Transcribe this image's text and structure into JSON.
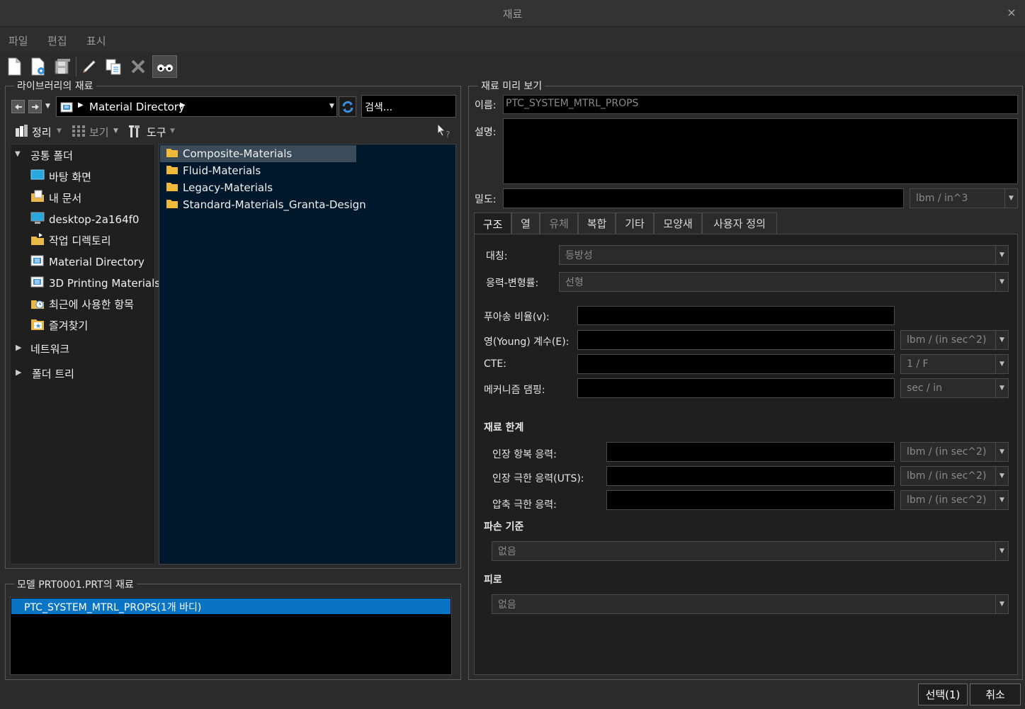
{
  "window": {
    "title": "재료",
    "close": "×"
  },
  "menu": [
    "파일",
    "편집",
    "표시"
  ],
  "library": {
    "group_title": "라이브러리의 재료",
    "path_label": "Material Directory",
    "search_placeholder": "검색...",
    "organize": "정리",
    "view": "보기",
    "tools": "도구",
    "tree": {
      "common_folders": "공통 폴더",
      "items": [
        "바탕 화면",
        "내 문서",
        "desktop-2a164f0",
        "작업 디렉토리",
        "Material Directory",
        "3D Printing Materials",
        "최근에 사용한 항목",
        "즐겨찾기"
      ],
      "network": "네트워크",
      "folder_tree": "폴더 트리"
    },
    "folders": [
      "Composite-Materials",
      "Fluid-Materials",
      "Legacy-Materials",
      "Standard-Materials_Granta-Design"
    ]
  },
  "model": {
    "group_title": "모델 PRT0001.PRT의 재료",
    "items": [
      "PTC_SYSTEM_MTRL_PROPS(1개 바디)"
    ]
  },
  "preview": {
    "group_title": "재료 미리 보기",
    "name_label": "이름:",
    "name_value": "PTC_SYSTEM_MTRL_PROPS",
    "desc_label": "설명:",
    "density_label": "밀도:",
    "density_unit": "lbm / in^3",
    "tabs": [
      "구조",
      "열",
      "유체",
      "복합",
      "기타",
      "모양새",
      "사용자 정의"
    ],
    "symmetry_label": "대칭:",
    "symmetry_value": "등방성",
    "stress_strain_label": "응력-변형률:",
    "stress_strain_value": "선형",
    "poisson_label": "푸아송 비율(v):",
    "young_label": "영(Young) 계수(E):",
    "young_unit": "lbm / (in sec^2)",
    "cte_label": "CTE:",
    "cte_unit": "1 / F",
    "damping_label": "메커니즘 댐핑:",
    "damping_unit": "sec / in",
    "limits_title": "재료 한계",
    "tensile_yield_label": "인장 항복 응력:",
    "tensile_yield_unit": "lbm / (in sec^2)",
    "tensile_ult_label": "인장 극한 응력(UTS):",
    "tensile_ult_unit": "lbm / (in sec^2)",
    "compressive_label": "압축 극한 응력:",
    "compressive_unit": "lbm / (in sec^2)",
    "failure_title": "파손 기준",
    "failure_value": "없음",
    "fatigue_title": "피로",
    "fatigue_value": "없음"
  },
  "buttons": {
    "select": "선택(1)",
    "cancel": "취소"
  }
}
